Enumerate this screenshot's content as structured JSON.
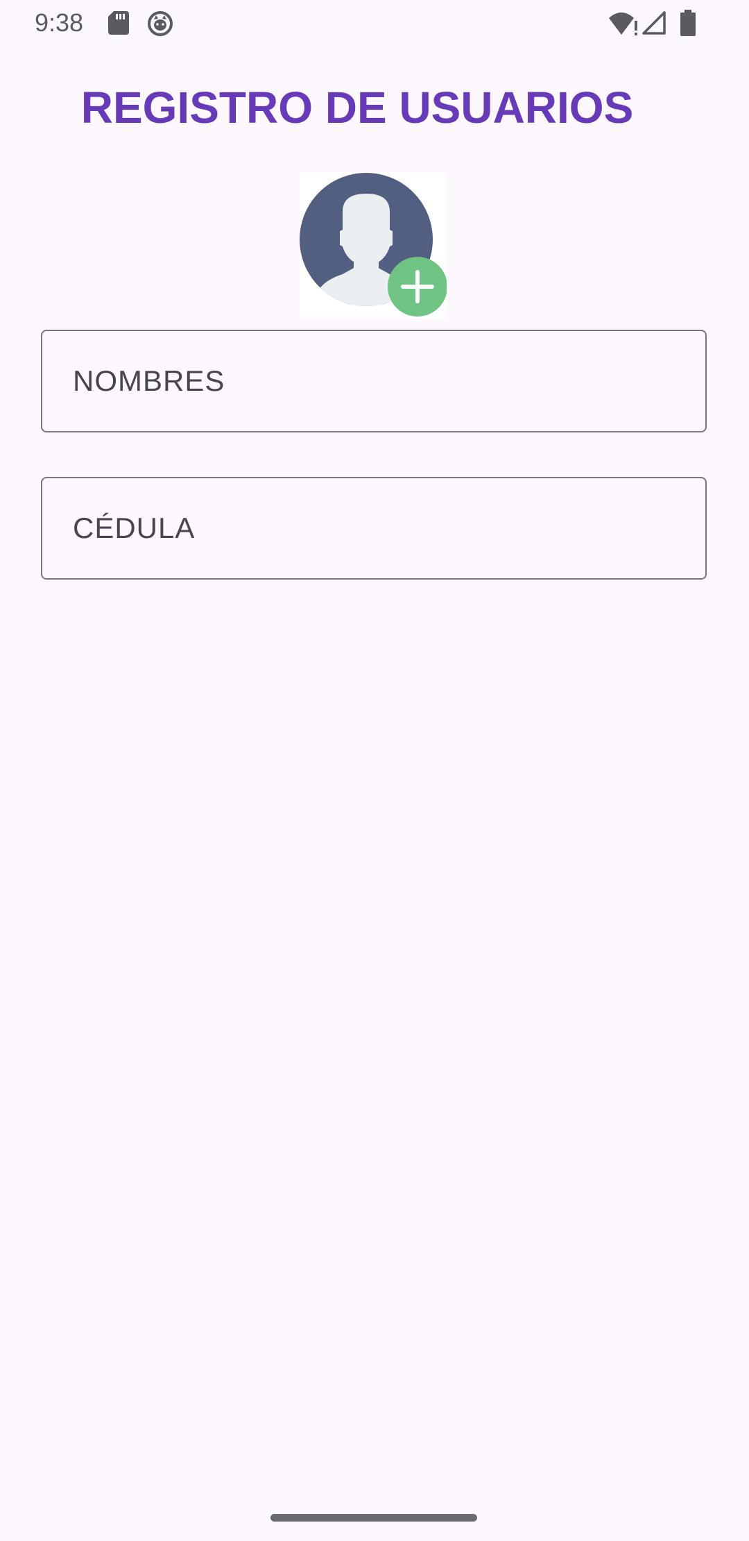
{
  "status_bar": {
    "time": "9:38",
    "icons": [
      "sd-card-icon",
      "cat-face-icon",
      "wifi-alert-icon",
      "cell-signal-icon",
      "battery-icon"
    ]
  },
  "header": {
    "title": "REGISTRO DE USUARIOS"
  },
  "avatar": {
    "icon": "user-avatar-icon",
    "add_icon": "add-photo-icon",
    "colors": {
      "circle": "#525f80",
      "silhouette": "#eceff1",
      "add_badge": "#6fc383"
    }
  },
  "form": {
    "nombres": {
      "placeholder": "NOMBRES",
      "value": ""
    },
    "cedula": {
      "placeholder": "CÉDULA",
      "value": ""
    }
  },
  "theme": {
    "accent": "#673ab7",
    "background": "#fdf7fe",
    "outline": "#79747e"
  }
}
